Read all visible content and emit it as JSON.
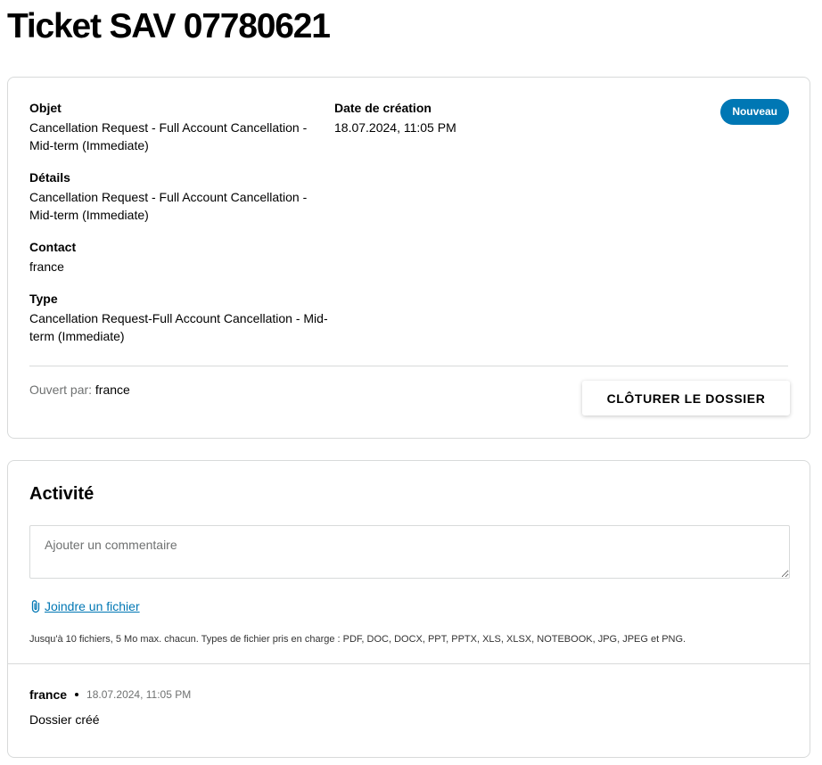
{
  "header": {
    "title": "Ticket SAV 07780621"
  },
  "ticket": {
    "status": "Nouveau",
    "fields": {
      "objet_label": "Objet",
      "objet_value": "Cancellation Request - Full Account Cancellation - Mid-term (Immediate)",
      "details_label": "Détails",
      "details_value": "Cancellation Request - Full Account Cancellation - Mid-term (Immediate)",
      "contact_label": "Contact",
      "contact_value": "france",
      "type_label": "Type",
      "type_value": "Cancellation Request-Full Account Cancellation - Mid-term (Immediate)",
      "date_label": "Date de création",
      "date_value": "18.07.2024, 11:05 PM"
    },
    "opened_by_label": "Ouvert par:",
    "opened_by_value": "france",
    "close_button_label": "CLÔTURER LE DOSSIER"
  },
  "activity": {
    "title": "Activité",
    "comment_placeholder": "Ajouter un commentaire",
    "attach_label": "Joindre un fichier",
    "file_hint": "Jusqu'à 10 fichiers, 5 Mo max. chacun. Types de fichier pris en charge : PDF, DOC, DOCX, PPT, PPTX, XLS, XLSX, NOTEBOOK, JPG, JPEG et PNG.",
    "entries": [
      {
        "author": "france",
        "time": "18.07.2024, 11:05 PM",
        "text": "Dossier créé"
      }
    ]
  },
  "colors": {
    "accent": "#0077b4",
    "border": "#d8dada",
    "muted_text": "#6f7171"
  },
  "icons": {
    "attach": "paperclip-icon"
  }
}
